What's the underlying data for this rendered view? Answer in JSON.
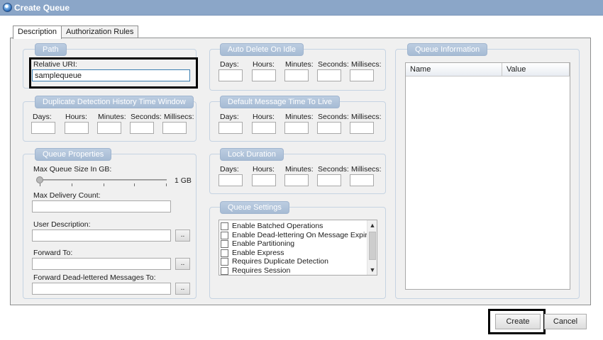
{
  "window": {
    "title": "Create Queue",
    "icon": "globe-icon"
  },
  "tabs": [
    {
      "label": "Description",
      "active": true
    },
    {
      "label": "Authorization Rules",
      "active": false
    }
  ],
  "path": {
    "title": "Path",
    "relative_uri_label": "Relative URI:",
    "relative_uri_value": "samplequeue"
  },
  "auto_delete": {
    "title": "Auto Delete On Idle",
    "days": "Days:",
    "hours": "Hours:",
    "minutes": "Minutes:",
    "seconds": "Seconds:",
    "millisecs": "Millisecs:"
  },
  "duplicate_detection": {
    "title": "Duplicate Detection History Time Window",
    "days": "Days:",
    "hours": "Hours:",
    "minutes": "Minutes:",
    "seconds": "Seconds:",
    "millisecs": "Millisecs:"
  },
  "default_ttl": {
    "title": "Default Message Time To Live",
    "days": "Days:",
    "hours": "Hours:",
    "minutes": "Minutes:",
    "seconds": "Seconds:",
    "millisecs": "Millisecs:"
  },
  "lock_duration": {
    "title": "Lock Duration",
    "days": "Days:",
    "hours": "Hours:",
    "minutes": "Minutes:",
    "seconds": "Seconds:",
    "millisecs": "Millisecs:"
  },
  "queue_properties": {
    "title": "Queue Properties",
    "max_size_label": "Max Queue Size In GB:",
    "max_size_value": "1 GB",
    "max_size_fraction": 0.0,
    "max_delivery_label": "Max Delivery Count:",
    "user_description_label": "User Description:",
    "forward_to_label": "Forward To:",
    "forward_deadletter_label": "Forward Dead-lettered Messages To:",
    "browse_label": ".."
  },
  "queue_settings": {
    "title": "Queue Settings",
    "items": [
      {
        "label": "Enable Batched Operations",
        "checked": false
      },
      {
        "label": "Enable Dead-lettering On Message Expiration",
        "checked": false
      },
      {
        "label": "Enable Partitioning",
        "checked": false
      },
      {
        "label": "Enable Express",
        "checked": false
      },
      {
        "label": "Requires Duplicate Detection",
        "checked": false
      },
      {
        "label": "Requires Session",
        "checked": false
      }
    ]
  },
  "queue_information": {
    "title": "Queue Information",
    "columns": [
      "Name",
      "Value"
    ]
  },
  "buttons": {
    "create": "Create",
    "cancel": "Cancel"
  },
  "colors": {
    "titlebar": "#8ba6c8",
    "group_title": "#a6bbd4",
    "highlight": "#000000"
  }
}
